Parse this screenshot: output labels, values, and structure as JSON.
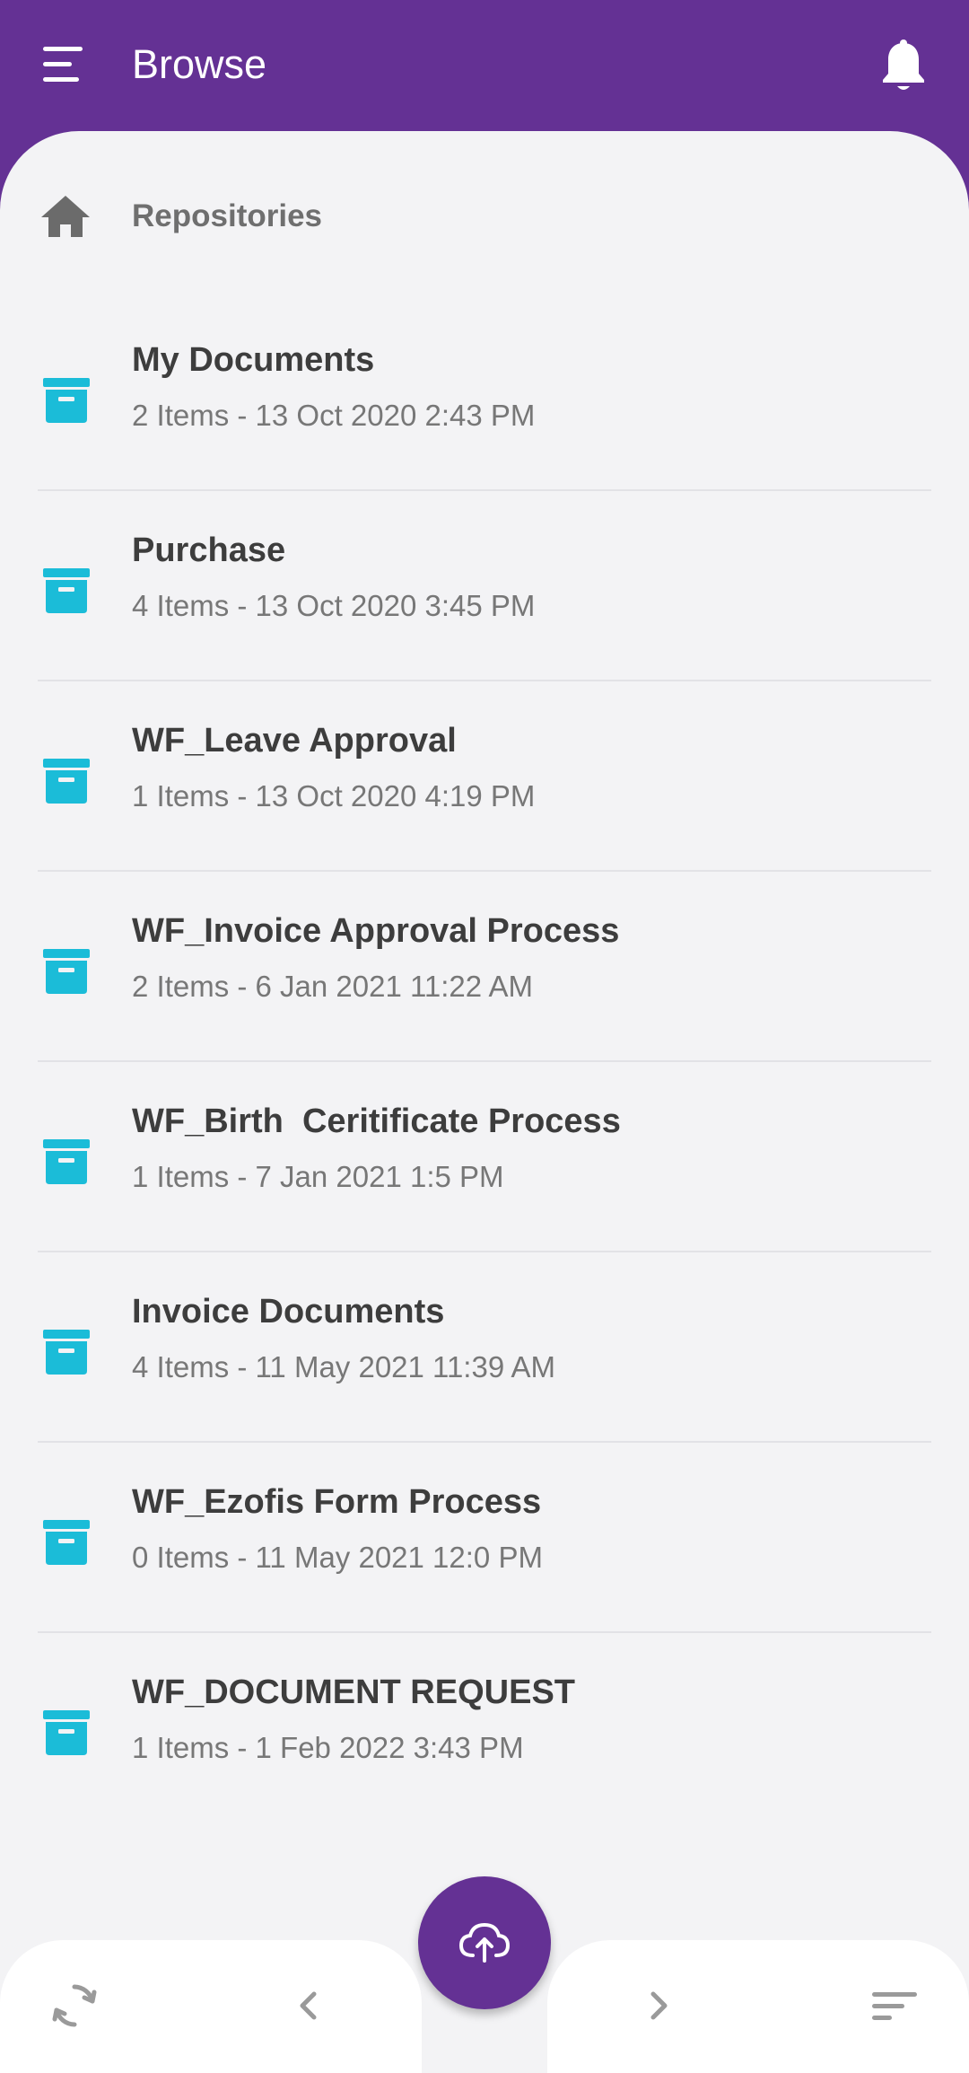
{
  "header": {
    "title": "Browse",
    "icons": {
      "menu": "menu-icon",
      "notifications": "bell-icon"
    }
  },
  "breadcrumb": {
    "label": "Repositories",
    "icon": "home-icon"
  },
  "repositories": [
    {
      "name": "My Documents",
      "meta": "2 Items - 13 Oct 2020 2:43 PM"
    },
    {
      "name": "Purchase",
      "meta": "4 Items - 13 Oct 2020 3:45 PM"
    },
    {
      "name": "WF_Leave Approval",
      "meta": "1 Items - 13 Oct 2020 4:19 PM"
    },
    {
      "name": "WF_Invoice Approval Process",
      "meta": "2 Items - 6 Jan 2021 11:22 AM"
    },
    {
      "name": "WF_Birth  Ceritificate Process",
      "meta": "1 Items - 7 Jan 2021 1:5 PM"
    },
    {
      "name": "Invoice Documents",
      "meta": "4 Items - 11 May 2021 11:39 AM"
    },
    {
      "name": "WF_Ezofis Form Process",
      "meta": "0 Items - 11 May 2021 12:0 PM"
    },
    {
      "name": "WF_DOCUMENT REQUEST",
      "meta": "1 Items - 1 Feb 2022 3:43 PM"
    }
  ],
  "bottom_bar": {
    "icons": [
      "refresh-icon",
      "chevron-left-icon",
      "upload-icon",
      "chevron-right-icon",
      "sort-icon"
    ]
  },
  "colors": {
    "primary": "#643194",
    "repository_icon": "#1bbcd8",
    "background": "#f3f3f5"
  }
}
